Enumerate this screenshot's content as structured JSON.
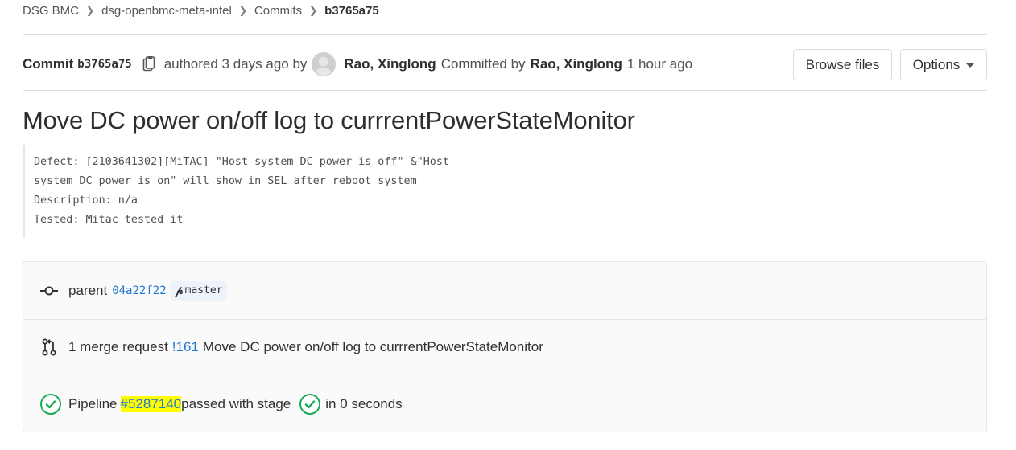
{
  "breadcrumb": {
    "items": [
      "DSG BMC",
      "dsg-openbmc-meta-intel",
      "Commits"
    ],
    "current": "b3765a75"
  },
  "commit": {
    "label": "Commit",
    "sha": "b3765a75",
    "authored_text": "authored 3 days ago by",
    "author": "Rao, Xinglong",
    "committed_by_text": "Committed by",
    "committer": "Rao, Xinglong",
    "committed_time": "1 hour ago"
  },
  "buttons": {
    "browse_files": "Browse files",
    "options": "Options"
  },
  "title": "Move DC power on/off log to currrentPowerStateMonitor",
  "message_lines": [
    "Defect: [2103641302][MiTAC] \"Host system DC power is off\" &\"Host",
    "system DC power is on\" will show in SEL after reboot system",
    "Description: n/a",
    "Tested: Mitac tested it"
  ],
  "parent": {
    "label": "parent",
    "sha": "04a22f22",
    "branch": "master"
  },
  "merge_request": {
    "count_text": "1 merge request",
    "id": "!161",
    "title": "Move DC power on/off log to currrentPowerStateMonitor"
  },
  "pipeline": {
    "label": "Pipeline",
    "id": "#5287140",
    "status_text": "passed with stage",
    "duration_text": "in 0 seconds",
    "status_color": "#1aaa55",
    "highlight_color": "#ffff00"
  },
  "colors": {
    "link": "#1f78d1",
    "border": "#dbdbdb",
    "text": "#303030"
  },
  "icons": {
    "breadcrumb_separator": "chevron-right-icon",
    "copy": "clipboard-icon",
    "commit": "commit-icon",
    "branch": "branch-icon",
    "merge_request": "merge-request-icon",
    "pipeline_status": "check-circle-icon"
  }
}
